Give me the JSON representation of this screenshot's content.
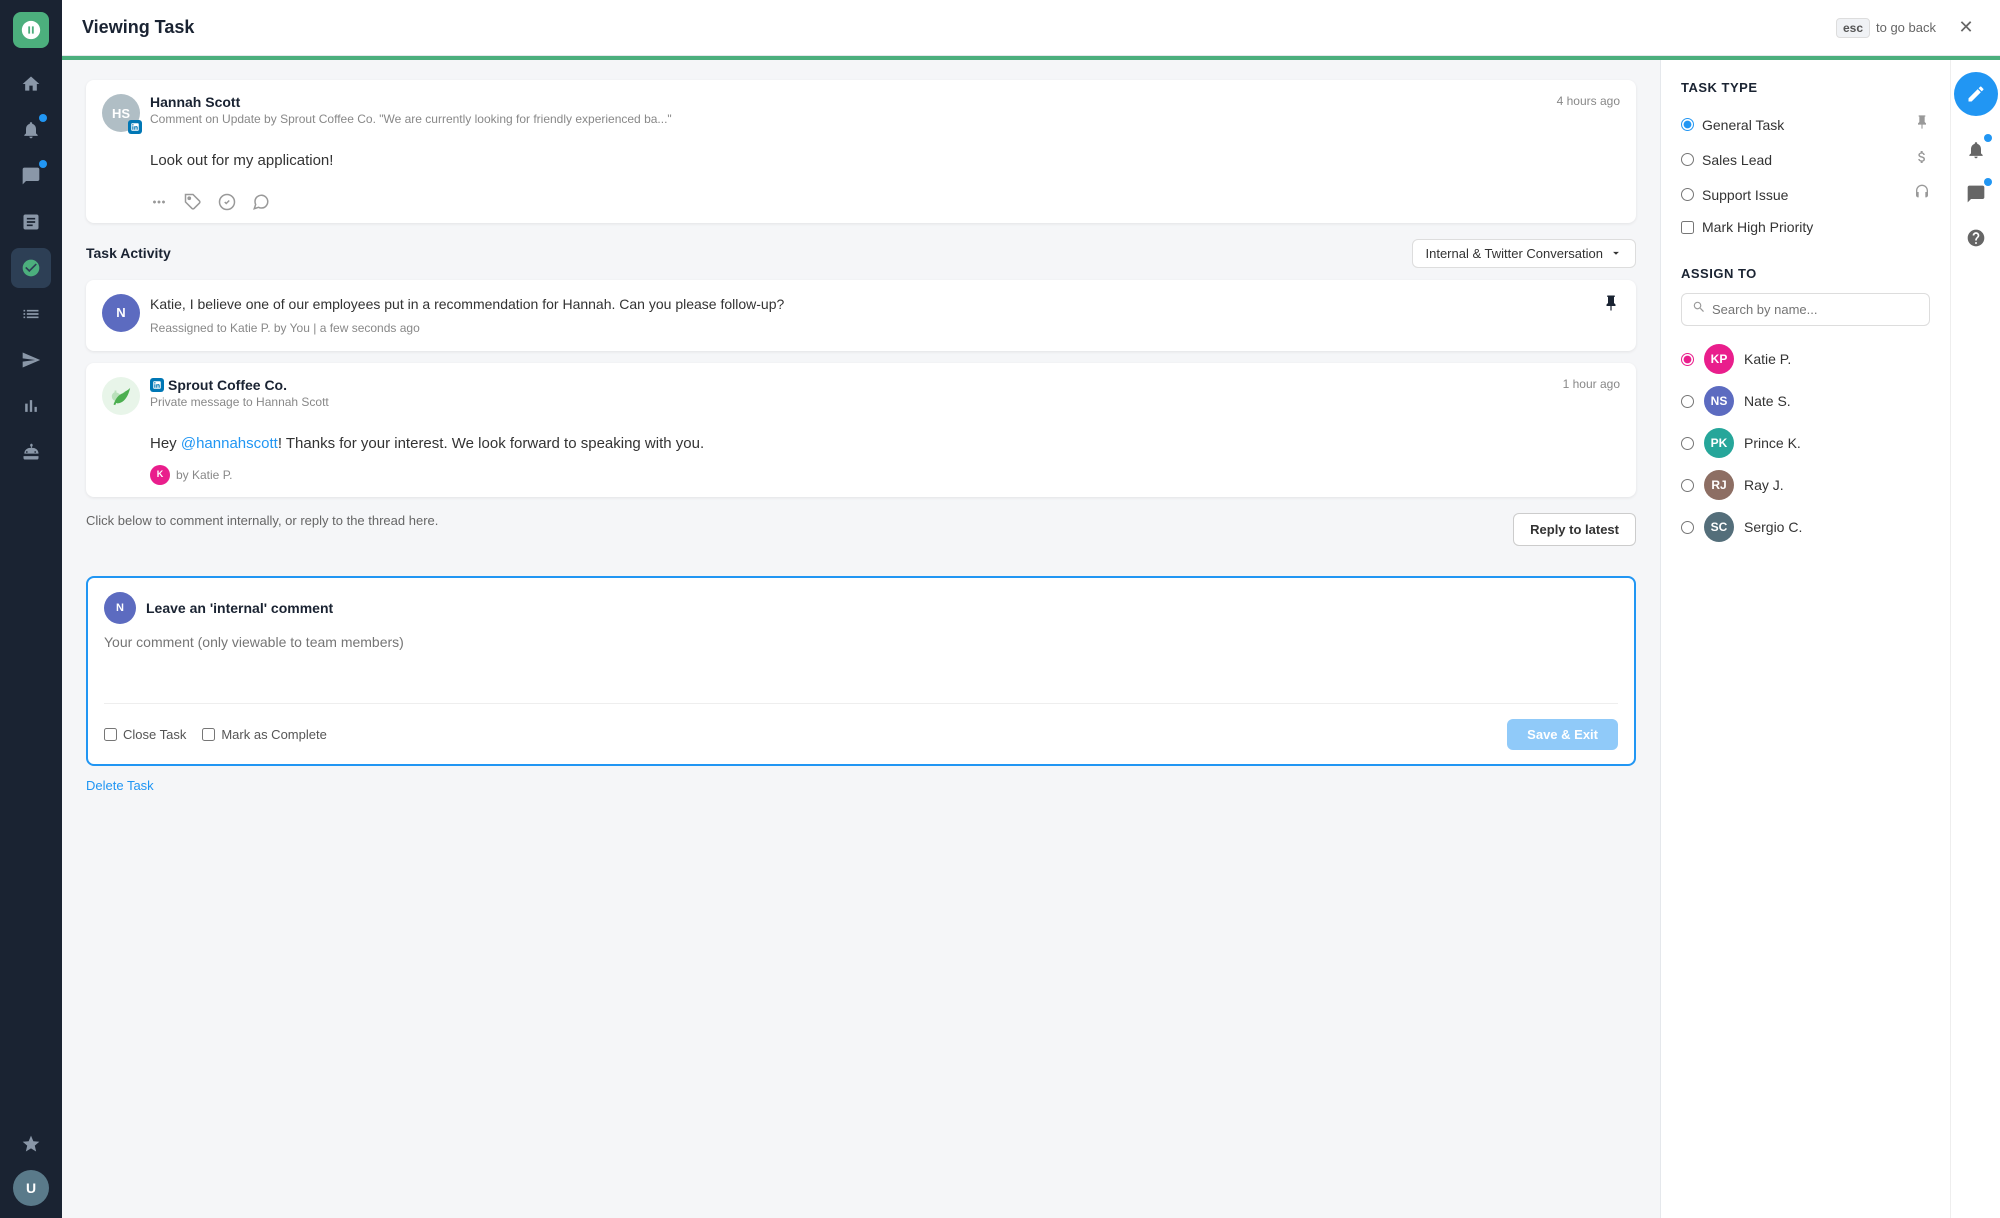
{
  "topbar": {
    "title": "Viewing Task",
    "esc_label": "esc",
    "go_back_label": "to go back"
  },
  "message": {
    "sender_name": "Hannah Scott",
    "sender_initials": "HS",
    "sender_context": "Comment on Update by Sprout Coffee Co. \"We are currently looking for friendly experienced ba...\"",
    "time": "4 hours ago",
    "body": "Look out for my application!"
  },
  "activity": {
    "section_title": "Task Activity",
    "filter_label": "Internal & Twitter Conversation",
    "internal_note": {
      "text": "Katie, I believe one of our employees put in a recommendation for Hannah. Can you please follow-up?",
      "meta": "Reassigned to Katie P. by You  |  a few seconds ago"
    },
    "sprout_message": {
      "sender": "Sprout Coffee Co.",
      "sender_sub": "Private message to Hannah Scott",
      "time": "1 hour ago",
      "body": "Hey @hannahscott! Thanks for your interest. We look forward to speaking with you.",
      "by": "by Katie P."
    }
  },
  "reply": {
    "hint": "Click below to comment internally, or reply to the thread here.",
    "reply_btn": "Reply to latest",
    "comment_box_title": "Leave an 'internal' comment",
    "comment_placeholder": "Your comment (only viewable to team members)",
    "close_task_label": "Close Task",
    "mark_complete_label": "Mark as Complete",
    "save_btn": "Save & Exit"
  },
  "delete": {
    "label": "Delete Task"
  },
  "task_type": {
    "section_title": "Task Type",
    "options": [
      {
        "label": "General Task",
        "icon": "pin",
        "selected": true
      },
      {
        "label": "Sales Lead",
        "icon": "dollar",
        "selected": false
      },
      {
        "label": "Support Issue",
        "icon": "headset",
        "selected": false
      }
    ],
    "high_priority_label": "Mark High Priority"
  },
  "assign_to": {
    "section_title": "Assign To",
    "search_placeholder": "Search by name...",
    "assignees": [
      {
        "name": "Katie P.",
        "initials": "KP",
        "color": "#e91e8c",
        "selected": true
      },
      {
        "name": "Nate S.",
        "initials": "NS",
        "color": "#5c6bc0",
        "selected": false
      },
      {
        "name": "Prince K.",
        "initials": "PK",
        "color": "#26a69a",
        "selected": false
      },
      {
        "name": "Ray J.",
        "initials": "RJ",
        "color": "#8d6e63",
        "selected": false
      },
      {
        "name": "Sergio C.",
        "initials": "SC",
        "color": "#546e7a",
        "selected": false
      }
    ]
  },
  "sidebar": {
    "items": [
      {
        "icon": "home",
        "active": false
      },
      {
        "icon": "bell",
        "active": false,
        "badge": true
      },
      {
        "icon": "message",
        "active": false,
        "badge": true
      },
      {
        "icon": "inbox",
        "active": false
      },
      {
        "icon": "tasks",
        "active": true
      },
      {
        "icon": "list",
        "active": false
      },
      {
        "icon": "send",
        "active": false
      },
      {
        "icon": "analytics",
        "active": false
      },
      {
        "icon": "bot",
        "active": false
      },
      {
        "icon": "star",
        "active": false
      }
    ]
  },
  "right_icons": [
    {
      "icon": "compose",
      "type": "compose"
    },
    {
      "icon": "bell",
      "badge": true
    },
    {
      "icon": "chat-bubble",
      "badge": true
    },
    {
      "icon": "question"
    }
  ]
}
